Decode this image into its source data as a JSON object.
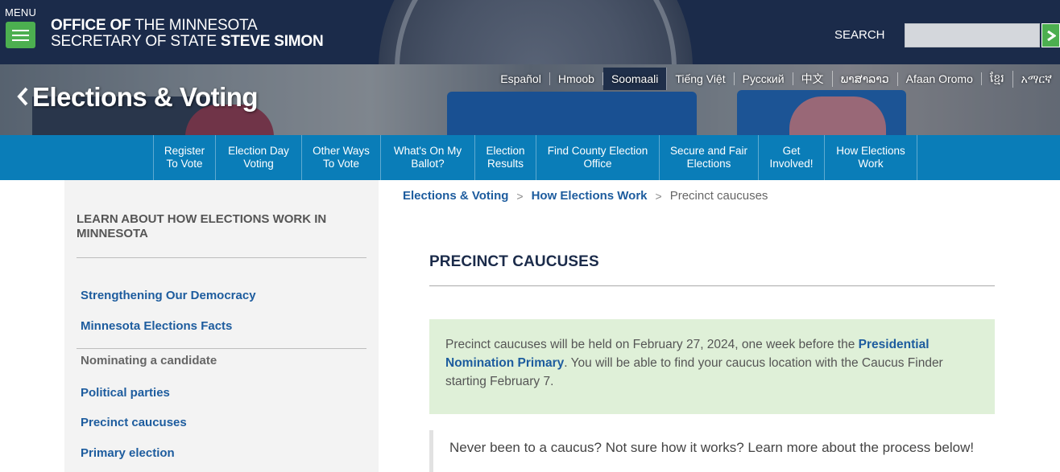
{
  "header": {
    "menu_label": "MENU",
    "office_line1_bold": "OFFICE OF",
    "office_line1_rest": " THE MINNESOTA",
    "office_line2_rest": "SECRETARY OF STATE ",
    "office_line2_bold": "STEVE SIMON",
    "search_label": "SEARCH",
    "search_value": ""
  },
  "hero": {
    "back_label": "Elections & Voting",
    "languages": [
      "Español",
      "Hmoob",
      "Soomaali",
      "Tiếng Việt",
      "Русский",
      "中文",
      "ພາສາລາວ",
      "Afaan Oromo",
      "ខ្មែរ",
      "አማርኛ"
    ],
    "active_language": "Soomaali"
  },
  "nav": {
    "items": [
      {
        "line1": "Register",
        "line2": "To Vote"
      },
      {
        "line1": "Election Day",
        "line2": "Voting"
      },
      {
        "line1": "Other Ways",
        "line2": "To Vote"
      },
      {
        "line1": "What's On My",
        "line2": "Ballot?"
      },
      {
        "line1": "Election",
        "line2": "Results"
      },
      {
        "line1": "Find County Election",
        "line2": "Office"
      },
      {
        "line1": "Secure and Fair",
        "line2": "Elections"
      },
      {
        "line1": "Get",
        "line2": "Involved!"
      },
      {
        "line1": "How Elections",
        "line2": "Work"
      }
    ]
  },
  "sidebar": {
    "title": "LEARN ABOUT HOW ELECTIONS WORK IN MINNESOTA",
    "links": [
      "Strengthening Our Democracy",
      "Minnesota Elections Facts"
    ],
    "section_heading": "Nominating a candidate",
    "section_links": [
      "Political parties",
      "Precinct caucuses",
      "Primary election"
    ]
  },
  "breadcrumb": {
    "items": [
      "Elections & Voting",
      "How Elections Work"
    ],
    "separator": ">",
    "current": "Precinct caucuses"
  },
  "main": {
    "title": "PRECINCT CAUCUSES",
    "notice_before": "Precinct caucuses will be held on February 27, 2024, one week before the ",
    "notice_link": "Presidential Nomination Primary",
    "notice_after": ". You will be able to find your caucus location with the Caucus Finder starting February 7.",
    "quote": "Never been to a caucus? Not sure how it works? Learn more about the process below!"
  }
}
